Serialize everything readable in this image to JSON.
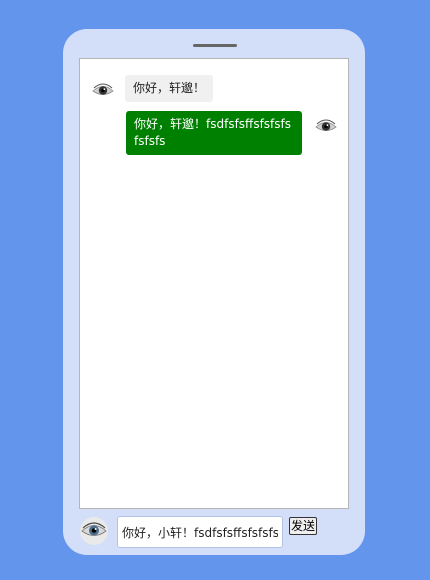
{
  "chat": {
    "messages": [
      {
        "side": "left",
        "avatar": "eye-avatar",
        "text": "你好，轩邈！"
      },
      {
        "side": "right",
        "avatar": "eye-avatar",
        "text": "你好，轩邈！fsdfsfsffsfsfsfsfsfsfs"
      }
    ]
  },
  "composer": {
    "avatar": "eye-avatar",
    "input_value": "你好，小轩！fsdfsfsffsfsfsfsfsfsfs",
    "send_label": "发送"
  },
  "colors": {
    "page_background": "#6495ed",
    "phone_body": "#d3dff9",
    "outgoing_bubble": "#008000",
    "incoming_bubble": "#f0f0f0"
  }
}
